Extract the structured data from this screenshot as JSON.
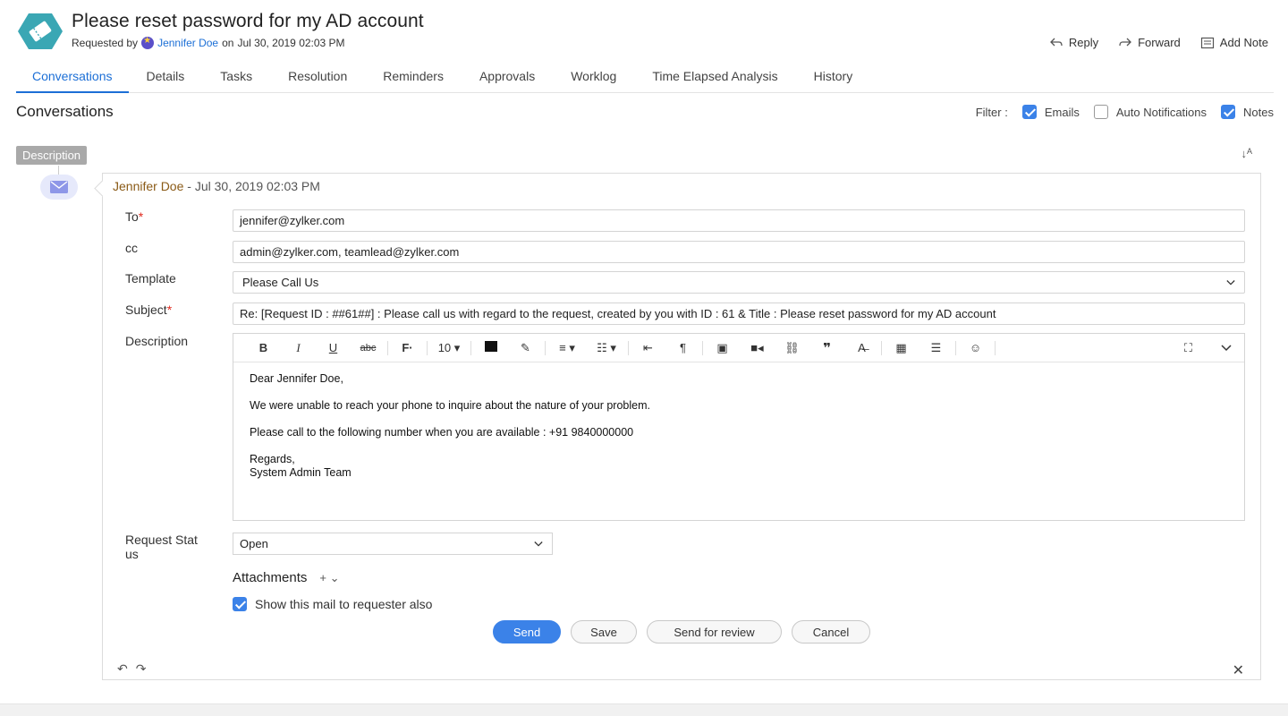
{
  "header": {
    "title": "Please reset password for my AD account",
    "requested_by_label": "Requested by",
    "requester": "Jennifer Doe",
    "on_label": "on",
    "date": "Jul 30, 2019 02:03 PM",
    "actions": [
      {
        "label": "Reply",
        "icon": "reply-icon"
      },
      {
        "label": "Forward",
        "icon": "forward-icon"
      },
      {
        "label": "Add Note",
        "icon": "note-icon"
      }
    ]
  },
  "tabs": [
    {
      "label": "Conversations",
      "active": true
    },
    {
      "label": "Details"
    },
    {
      "label": "Tasks"
    },
    {
      "label": "Resolution"
    },
    {
      "label": "Reminders"
    },
    {
      "label": "Approvals"
    },
    {
      "label": "Worklog"
    },
    {
      "label": "Time Elapsed Analysis"
    },
    {
      "label": "History"
    }
  ],
  "conversations": {
    "title": "Conversations",
    "filter_label": "Filter :",
    "filters": [
      {
        "label": "Emails",
        "checked": true
      },
      {
        "label": "Auto Notifications",
        "checked": false
      },
      {
        "label": "Notes",
        "checked": true
      }
    ],
    "description_tag": "Description"
  },
  "reply": {
    "author": "Jennifer Doe",
    "time": "- Jul 30, 2019 02:03 PM",
    "to_label": "To",
    "to_value": "jennifer@zylker.com",
    "cc_label": "cc",
    "cc_value": "admin@zylker.com, teamlead@zylker.com",
    "template_label": "Template",
    "template_value": "Please Call Us",
    "subject_label": "Subject",
    "subject_value": "Re: [Request ID : ##61##] : Please call us with regard to the request, created by you with ID : 61 & Title : Please reset password for my AD account",
    "description_label": "Description",
    "toolbar": {
      "font_size": "10"
    },
    "body": {
      "greeting": "Dear Jennifer Doe,",
      "line1": "We were unable to reach your phone to inquire about the nature of your problem.",
      "line2": "Please call to the following number when you are available : +91 9840000000",
      "sign1": "Regards,",
      "sign2": "System Admin Team"
    },
    "status_label_1": "Request Stat",
    "status_label_2": "us",
    "status_value": "Open",
    "attachments_label": "Attachments",
    "show_mail_label": "Show this mail to requester also",
    "show_mail_checked": true,
    "buttons": {
      "send": "Send",
      "save": "Save",
      "send_for_review": "Send for review",
      "cancel": "Cancel"
    }
  },
  "colors": {
    "accent": "#1c6fd6",
    "primary_button": "#3b82e8",
    "author_name": "#8a5a16",
    "required_star": "#e0291e",
    "ticket_icon": "#3aa7b4"
  }
}
